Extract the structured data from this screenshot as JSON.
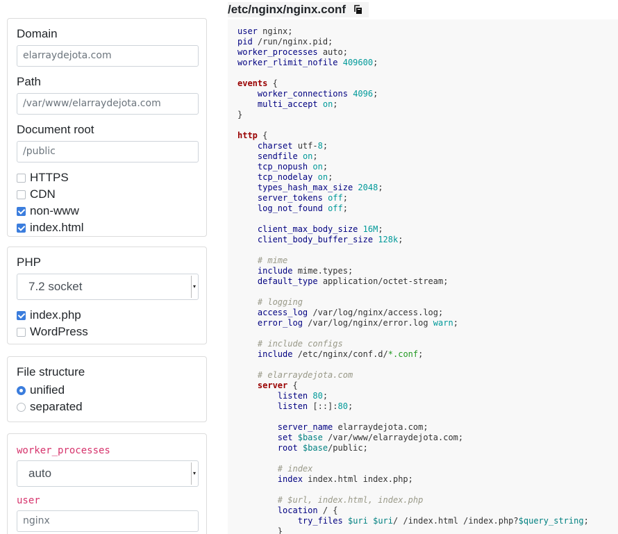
{
  "domain_card": {
    "domain_label": "Domain",
    "domain_value": "elarraydejota.com",
    "path_label": "Path",
    "path_value": "/var/www/elarraydejota.com",
    "docroot_label": "Document root",
    "docroot_value": "/public",
    "checks": [
      {
        "label": "HTTPS",
        "checked": false
      },
      {
        "label": "CDN",
        "checked": false
      },
      {
        "label": "non-www",
        "checked": true
      },
      {
        "label": "index.html",
        "checked": true
      }
    ]
  },
  "php_card": {
    "php_label": "PHP",
    "php_select": "7.2 socket",
    "checks": [
      {
        "label": "index.php",
        "checked": true
      },
      {
        "label": "WordPress",
        "checked": false
      }
    ]
  },
  "structure_card": {
    "title": "File structure",
    "options": [
      {
        "label": "unified",
        "selected": true
      },
      {
        "label": "separated",
        "selected": false
      }
    ]
  },
  "global_card": {
    "worker_label": "worker_processes",
    "worker_select": "auto",
    "user_label": "user",
    "user_value": "nginx"
  },
  "file": {
    "title": "/etc/nginx/nginx.conf",
    "copy_icon": "copy-icon"
  },
  "code_lines": [
    [
      [
        "kw",
        "user"
      ],
      [
        "plain",
        " nginx;"
      ]
    ],
    [
      [
        "kw",
        "pid"
      ],
      [
        "plain",
        " /run/nginx.pid;"
      ]
    ],
    [
      [
        "kw",
        "worker_processes"
      ],
      [
        "plain",
        " auto;"
      ]
    ],
    [
      [
        "kw",
        "worker_rlimit_nofile"
      ],
      [
        "plain",
        " "
      ],
      [
        "num",
        "409600"
      ],
      [
        "plain",
        ";"
      ]
    ],
    [],
    [
      [
        "blk",
        "events"
      ],
      [
        "plain",
        " {"
      ]
    ],
    [
      [
        "plain",
        "    "
      ],
      [
        "kw",
        "worker_connections"
      ],
      [
        "plain",
        " "
      ],
      [
        "num",
        "4096"
      ],
      [
        "plain",
        ";"
      ]
    ],
    [
      [
        "plain",
        "    "
      ],
      [
        "kw",
        "multi_accept"
      ],
      [
        "plain",
        " "
      ],
      [
        "num",
        "on"
      ],
      [
        "plain",
        ";"
      ]
    ],
    [
      [
        "plain",
        "}"
      ]
    ],
    [],
    [
      [
        "blk",
        "http"
      ],
      [
        "plain",
        " {"
      ]
    ],
    [
      [
        "plain",
        "    "
      ],
      [
        "kw",
        "charset"
      ],
      [
        "plain",
        " utf-"
      ],
      [
        "num",
        "8"
      ],
      [
        "plain",
        ";"
      ]
    ],
    [
      [
        "plain",
        "    "
      ],
      [
        "kw",
        "sendfile"
      ],
      [
        "plain",
        " "
      ],
      [
        "num",
        "on"
      ],
      [
        "plain",
        ";"
      ]
    ],
    [
      [
        "plain",
        "    "
      ],
      [
        "kw",
        "tcp_nopush"
      ],
      [
        "plain",
        " "
      ],
      [
        "num",
        "on"
      ],
      [
        "plain",
        ";"
      ]
    ],
    [
      [
        "plain",
        "    "
      ],
      [
        "kw",
        "tcp_nodelay"
      ],
      [
        "plain",
        " "
      ],
      [
        "num",
        "on"
      ],
      [
        "plain",
        ";"
      ]
    ],
    [
      [
        "plain",
        "    "
      ],
      [
        "kw",
        "types_hash_max_size"
      ],
      [
        "plain",
        " "
      ],
      [
        "num",
        "2048"
      ],
      [
        "plain",
        ";"
      ]
    ],
    [
      [
        "plain",
        "    "
      ],
      [
        "kw",
        "server_tokens"
      ],
      [
        "plain",
        " "
      ],
      [
        "num",
        "off"
      ],
      [
        "plain",
        ";"
      ]
    ],
    [
      [
        "plain",
        "    "
      ],
      [
        "kw",
        "log_not_found"
      ],
      [
        "plain",
        " "
      ],
      [
        "num",
        "off"
      ],
      [
        "plain",
        ";"
      ]
    ],
    [],
    [
      [
        "plain",
        "    "
      ],
      [
        "kw",
        "client_max_body_size"
      ],
      [
        "plain",
        " "
      ],
      [
        "num",
        "16M"
      ],
      [
        "plain",
        ";"
      ]
    ],
    [
      [
        "plain",
        "    "
      ],
      [
        "kw",
        "client_body_buffer_size"
      ],
      [
        "plain",
        " "
      ],
      [
        "num",
        "128k"
      ],
      [
        "plain",
        ";"
      ]
    ],
    [],
    [
      [
        "plain",
        "    "
      ],
      [
        "cmt",
        "# mime"
      ]
    ],
    [
      [
        "plain",
        "    "
      ],
      [
        "kw",
        "include"
      ],
      [
        "plain",
        " mime.types;"
      ]
    ],
    [
      [
        "plain",
        "    "
      ],
      [
        "kw",
        "default_type"
      ],
      [
        "plain",
        " application/octet-stream;"
      ]
    ],
    [],
    [
      [
        "plain",
        "    "
      ],
      [
        "cmt",
        "# logging"
      ]
    ],
    [
      [
        "plain",
        "    "
      ],
      [
        "kw",
        "access_log"
      ],
      [
        "plain",
        " /var/log/nginx/access.log;"
      ]
    ],
    [
      [
        "plain",
        "    "
      ],
      [
        "kw",
        "error_log"
      ],
      [
        "plain",
        " /var/log/nginx/error.log "
      ],
      [
        "num",
        "warn"
      ],
      [
        "plain",
        ";"
      ]
    ],
    [],
    [
      [
        "plain",
        "    "
      ],
      [
        "cmt",
        "# include configs"
      ]
    ],
    [
      [
        "plain",
        "    "
      ],
      [
        "kw",
        "include"
      ],
      [
        "plain",
        " /etc/nginx/conf.d/"
      ],
      [
        "str",
        "*.conf"
      ],
      [
        "plain",
        ";"
      ]
    ],
    [],
    [
      [
        "plain",
        "    "
      ],
      [
        "cmt",
        "# elarraydejota.com"
      ]
    ],
    [
      [
        "plain",
        "    "
      ],
      [
        "blk",
        "server"
      ],
      [
        "plain",
        " {"
      ]
    ],
    [
      [
        "plain",
        "        "
      ],
      [
        "kw",
        "listen"
      ],
      [
        "plain",
        " "
      ],
      [
        "num",
        "80"
      ],
      [
        "plain",
        ";"
      ]
    ],
    [
      [
        "plain",
        "        "
      ],
      [
        "kw",
        "listen"
      ],
      [
        "plain",
        " [::]:"
      ],
      [
        "num",
        "80"
      ],
      [
        "plain",
        ";"
      ]
    ],
    [],
    [
      [
        "plain",
        "        "
      ],
      [
        "kw",
        "server_name"
      ],
      [
        "plain",
        " elarraydejota.com;"
      ]
    ],
    [
      [
        "plain",
        "        "
      ],
      [
        "kw",
        "set"
      ],
      [
        "plain",
        " "
      ],
      [
        "var",
        "$base"
      ],
      [
        "plain",
        " /var/www/elarraydejota.com;"
      ]
    ],
    [
      [
        "plain",
        "        "
      ],
      [
        "kw",
        "root"
      ],
      [
        "plain",
        " "
      ],
      [
        "var",
        "$base"
      ],
      [
        "plain",
        "/public;"
      ]
    ],
    [],
    [
      [
        "plain",
        "        "
      ],
      [
        "cmt",
        "# index"
      ]
    ],
    [
      [
        "plain",
        "        "
      ],
      [
        "kw",
        "index"
      ],
      [
        "plain",
        " index.html index.php;"
      ]
    ],
    [],
    [
      [
        "plain",
        "        "
      ],
      [
        "cmt",
        "# $url, index.html, index.php"
      ]
    ],
    [
      [
        "plain",
        "        "
      ],
      [
        "kw",
        "location"
      ],
      [
        "plain",
        " / {"
      ]
    ],
    [
      [
        "plain",
        "            "
      ],
      [
        "kw",
        "try_files"
      ],
      [
        "plain",
        " "
      ],
      [
        "var",
        "$uri"
      ],
      [
        "plain",
        " "
      ],
      [
        "var",
        "$uri"
      ],
      [
        "plain",
        "/ /index.html /index.php?"
      ],
      [
        "var",
        "$query_string"
      ],
      [
        "plain",
        ";"
      ]
    ],
    [
      [
        "plain",
        "        }"
      ]
    ]
  ]
}
